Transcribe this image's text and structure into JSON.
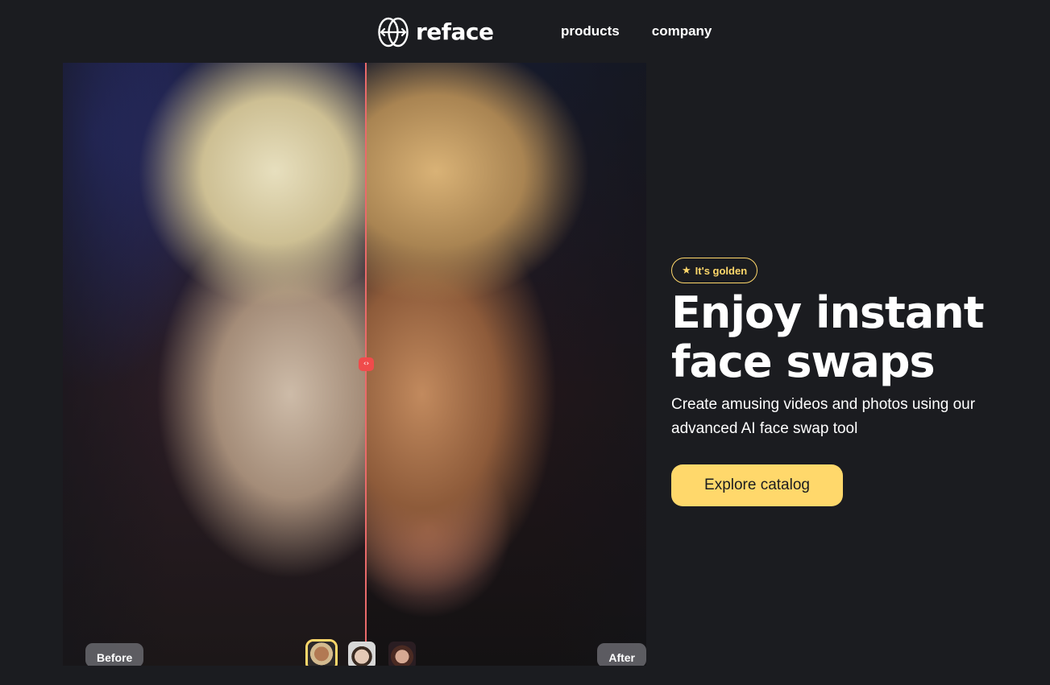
{
  "header": {
    "logo_text": "reface",
    "nav": [
      {
        "label": "products"
      },
      {
        "label": "company"
      }
    ]
  },
  "compare": {
    "before_label": "Before",
    "after_label": "After",
    "handle_glyph": "‹›",
    "slider_position_percent": 52,
    "thumbnails": [
      {
        "icon": "face-thumbnail-1",
        "selected": true
      },
      {
        "icon": "face-thumbnail-2",
        "selected": false
      },
      {
        "icon": "face-thumbnail-3",
        "selected": false
      }
    ]
  },
  "hero": {
    "badge_icon": "star-icon",
    "badge_label": "It's golden",
    "headline_line1": "Enjoy instant",
    "headline_line2": "face swaps",
    "subtext": "Create amusing videos and photos using our advanced AI face swap tool",
    "cta_label": "Explore catalog"
  },
  "colors": {
    "background": "#1b1c20",
    "accent": "#ffd86b",
    "divider": "#e96a6a",
    "handle": "#f04b4b"
  }
}
